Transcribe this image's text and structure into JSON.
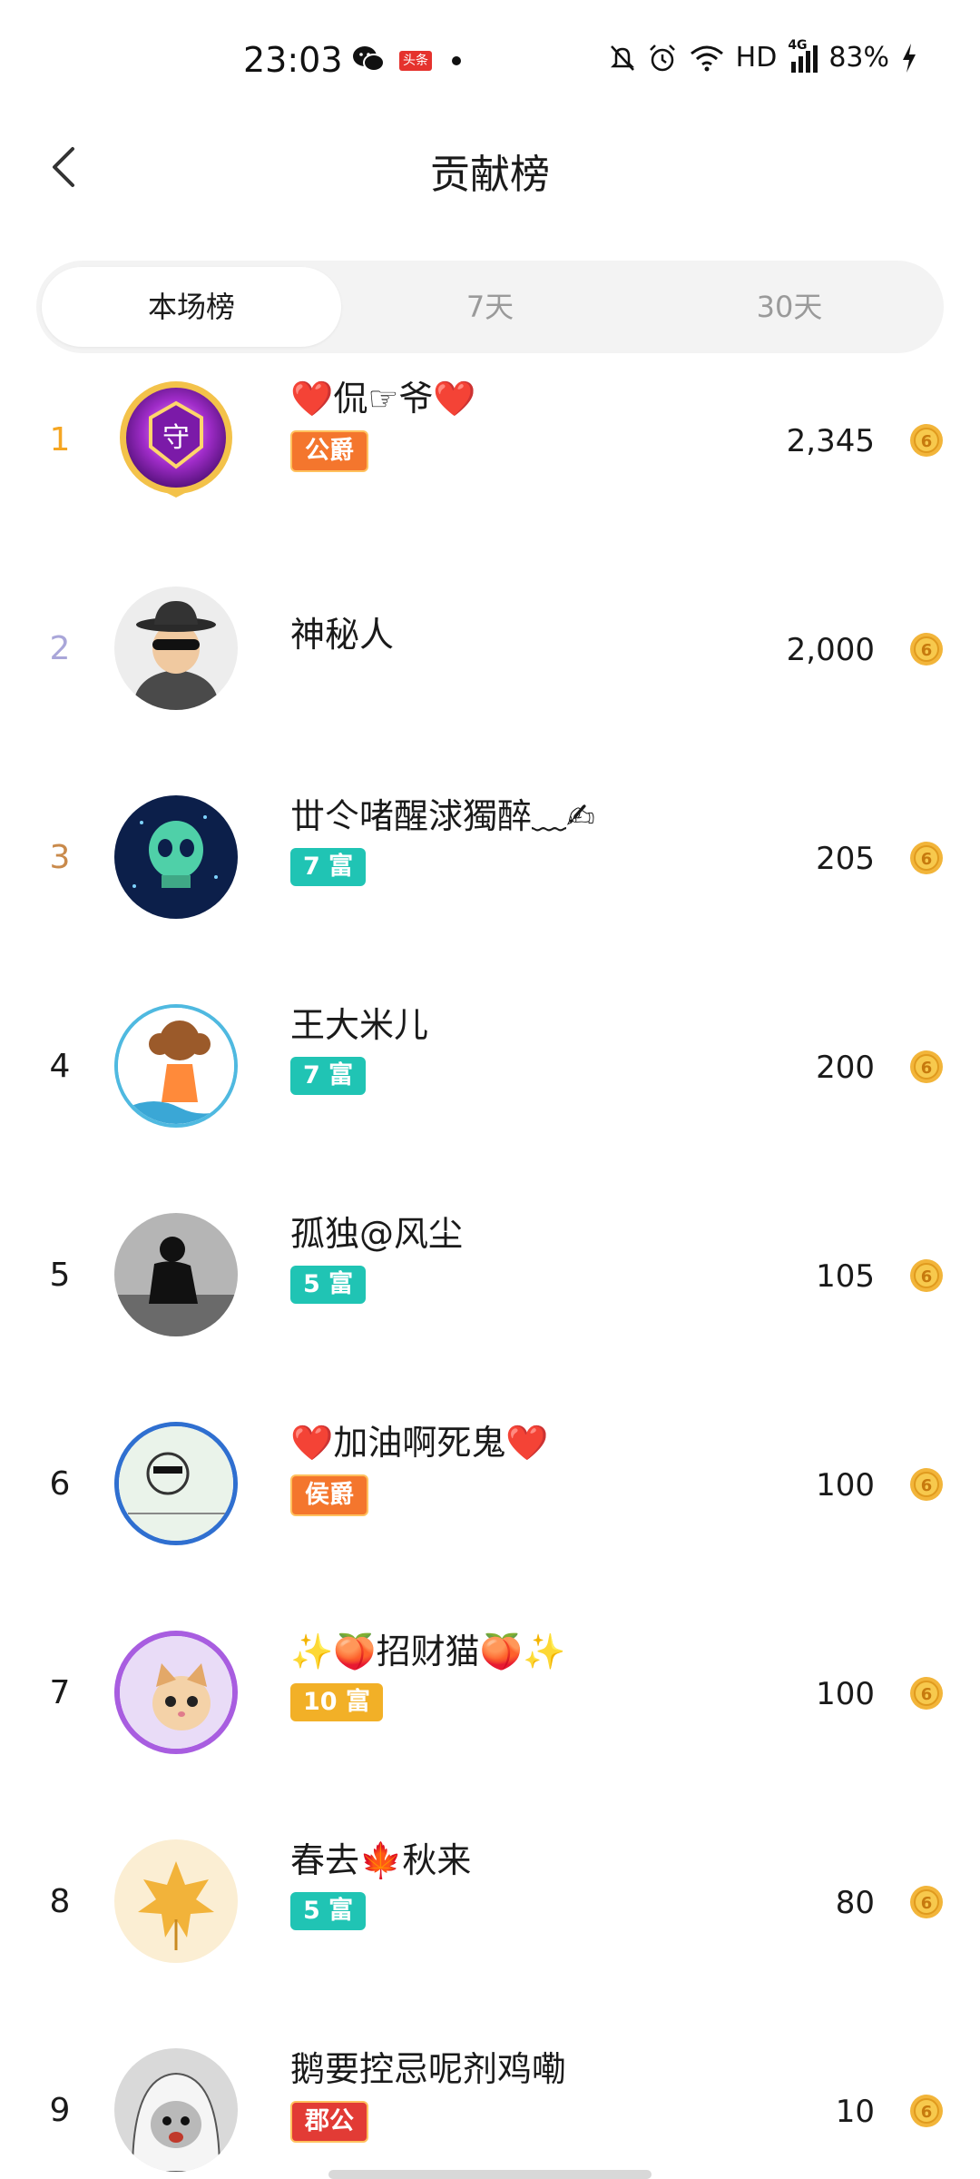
{
  "status_bar": {
    "time": "23:03",
    "toutiao_label": "头条",
    "network": "HD",
    "network_type": "4G",
    "battery": "83%"
  },
  "header": {
    "title": "贡献榜"
  },
  "tabs": [
    {
      "label": "本场榜",
      "active": true
    },
    {
      "label": "7天",
      "active": false
    },
    {
      "label": "30天",
      "active": false
    }
  ],
  "colors": {
    "rank_1": "#f5a623",
    "rank_2": "#a9a6d9",
    "rank_3": "#c98a4b",
    "badge_teal": "#20c4b4",
    "badge_gold": "#f2b027",
    "badge_orange": "#f4762d",
    "badge_red": "#e23b35"
  },
  "entries": [
    {
      "rank": "1",
      "name": "❤️侃☞爷❤️",
      "badge": "公爵",
      "badge_type": "noble-orange",
      "score": "2,345"
    },
    {
      "rank": "2",
      "name": "神秘人",
      "badge": "",
      "badge_type": "",
      "score": "2,000"
    },
    {
      "rank": "3",
      "name": "丗仒啫醒浗獨醉﹏✍",
      "badge": "7 富",
      "badge_type": "teal",
      "score": "205"
    },
    {
      "rank": "4",
      "name": "王大米儿",
      "badge": "7 富",
      "badge_type": "teal",
      "score": "200"
    },
    {
      "rank": "5",
      "name": "孤独@风尘",
      "badge": "5 富",
      "badge_type": "teal",
      "score": "105"
    },
    {
      "rank": "6",
      "name": "❤️加油啊死鬼❤️",
      "badge": "侯爵",
      "badge_type": "noble-orange",
      "score": "100"
    },
    {
      "rank": "7",
      "name": "✨🍑招财猫🍑✨",
      "badge": "10 富",
      "badge_type": "gold",
      "score": "100"
    },
    {
      "rank": "8",
      "name": "春去🍁秋来",
      "badge": "5 富",
      "badge_type": "teal",
      "score": "80"
    },
    {
      "rank": "9",
      "name": "鹅要控忌呢剂鸡嘞",
      "badge": "郡公",
      "badge_type": "noble-red",
      "score": "10"
    }
  ],
  "avatar_icons": [
    "guardian-crest-avatar-icon",
    "mystery-man-avatar-icon",
    "skull-avatar-icon",
    "girl-avatar-icon",
    "silhouette-avatar-icon",
    "meme-avatar-icon",
    "cat-avatar-icon",
    "maple-leaf-avatar-icon",
    "cat-hood-avatar-icon"
  ],
  "coin_icon": "coin-icon"
}
